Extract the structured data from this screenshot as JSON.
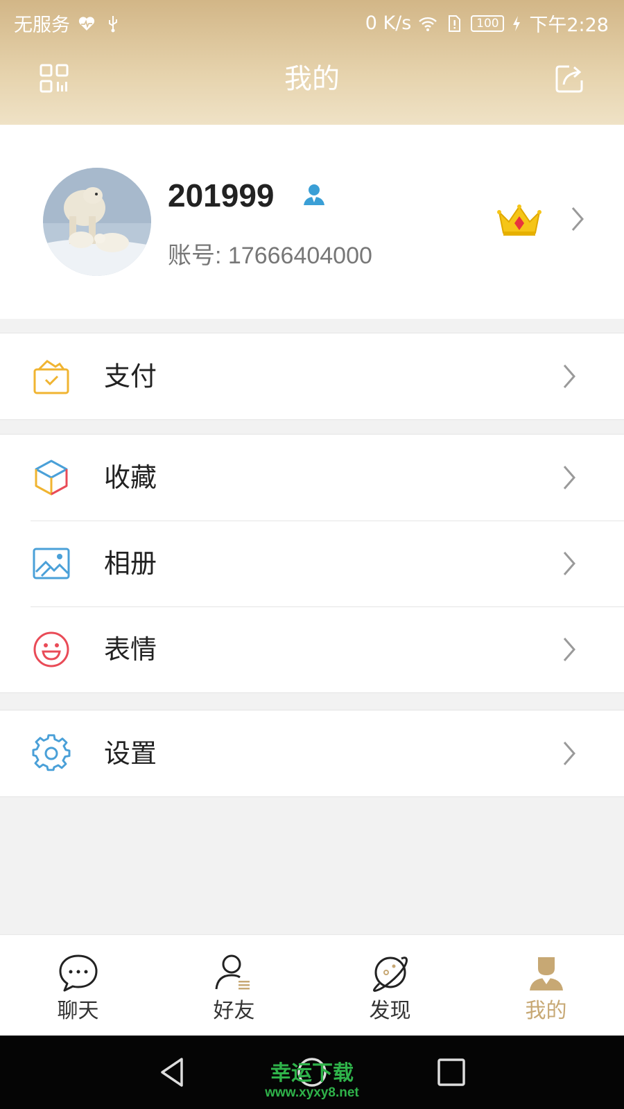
{
  "status_bar": {
    "carrier": "无服务",
    "net_speed": "0 K/s",
    "battery": "100",
    "time": "下午2:28",
    "icons": [
      "heart-pulse-icon",
      "usb-icon",
      "wifi-icon",
      "sim-alert-icon",
      "battery-icon",
      "charging-icon"
    ]
  },
  "header": {
    "title": "我的",
    "left_icon": "qr-code-icon",
    "right_icon": "share-icon",
    "gradient": [
      "#d2b687",
      "#efe2c6"
    ]
  },
  "profile": {
    "nickname": "201999",
    "account": "账号: 17666404000",
    "badge_icon": "user-icon",
    "vip_icon": "crown-icon"
  },
  "menu": {
    "groups": [
      [
        {
          "label": "支付",
          "icon": "wallet-icon",
          "color": "#f0b431"
        }
      ],
      [
        {
          "label": "收藏",
          "icon": "cube-icon",
          "color": "#f0b431"
        },
        {
          "label": "相册",
          "icon": "image-icon",
          "color": "#4aa0d8"
        },
        {
          "label": "表情",
          "icon": "smiley-icon",
          "color": "#e94b57"
        }
      ],
      [
        {
          "label": "设置",
          "icon": "gear-icon",
          "color": "#4aa0d8"
        }
      ]
    ]
  },
  "bottom_nav": {
    "active_color": "#c7a874",
    "tabs": [
      {
        "label": "聊天",
        "icon": "chat-bubble-icon"
      },
      {
        "label": "好友",
        "icon": "contacts-icon"
      },
      {
        "label": "发现",
        "icon": "planet-icon"
      },
      {
        "label": "我的",
        "icon": "person-icon",
        "active": true
      }
    ]
  },
  "watermark": {
    "text": "幸运下载",
    "url": "www.xyxy8.net"
  }
}
